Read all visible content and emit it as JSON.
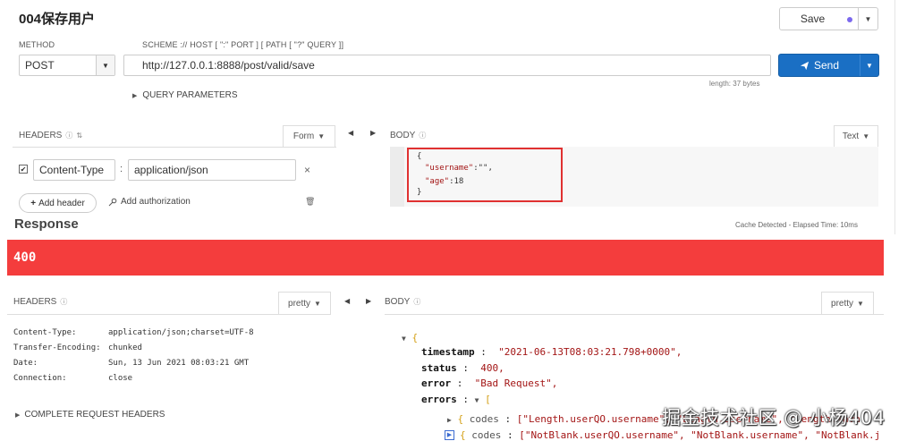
{
  "request": {
    "title": "004保存用户",
    "save_label": "Save",
    "method_label": "METHOD",
    "method_value": "POST",
    "scheme_label": "SCHEME :// HOST [ \":\" PORT ] [ PATH [ \"?\" QUERY ]]",
    "url": "http://127.0.0.1:8888/post/valid/save",
    "length_text": "length: 37 bytes",
    "send_label": "Send",
    "query_params_label": "QUERY PARAMETERS",
    "headers_label": "HEADERS",
    "form_label": "Form",
    "body_label": "BODY",
    "text_label": "Text",
    "header_key": "Content-Type",
    "header_colon": ":",
    "header_value": "application/json",
    "add_header_label": "Add header",
    "add_auth_label": "Add authorization",
    "body_lines": {
      "l1": "{",
      "l2_key": "\"username\"",
      "l2_rest": ":\"\",",
      "l3_key": "\"age\"",
      "l3_rest": ":18",
      "l4": "}"
    }
  },
  "response": {
    "title": "Response",
    "cache_text": "Cache Detected - Elapsed Time: 10ms",
    "status_code": "400",
    "status_color": "#f43d3d",
    "headers_label": "HEADERS",
    "pretty_label": "pretty",
    "body_label": "BODY",
    "headers": [
      {
        "key": "Content-Type:",
        "value": "application/json;charset=UTF-8"
      },
      {
        "key": "Transfer-Encoding:",
        "value": "chunked"
      },
      {
        "key": "Date:",
        "value": "Sun, 13 Jun 2021 08:03:21 GMT"
      },
      {
        "key": "Connection:",
        "value": "close"
      }
    ],
    "complete_request_label": "COMPLETE REQUEST HEADERS",
    "json": {
      "timestamp_key": "timestamp",
      "timestamp_val": "\"2021-06-13T08:03:21.798+0000\",",
      "status_key": "status",
      "status_val": "400,",
      "error_key": "error",
      "error_val": "\"Bad Request\",",
      "errors_key": "errors",
      "codes_key": "codes",
      "codes1_val": "[\"Length.userQO.username\", \"Length.username\", \"Length.java",
      "codes2_val": "[\"NotBlank.userQO.username\", \"NotBlank.username\", \"NotBlank.j"
    }
  },
  "watermark": "掘金技术社区 @ 小杨404",
  "accent_color": "#1a6fc4"
}
